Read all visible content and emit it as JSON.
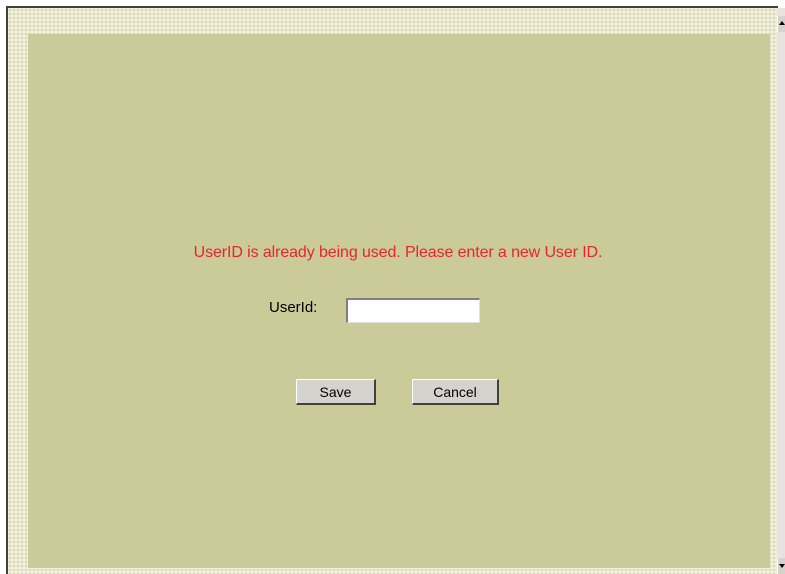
{
  "message": {
    "error_text": "UserID is already being used. Please enter a new User ID.",
    "error_color": "#e8252a"
  },
  "form": {
    "userid_label": "UserId:",
    "userid_value": ""
  },
  "buttons": {
    "save_label": "Save",
    "cancel_label": "Cancel"
  },
  "colors": {
    "panel_background": "#cbca99",
    "button_face": "#d6d3ce"
  }
}
